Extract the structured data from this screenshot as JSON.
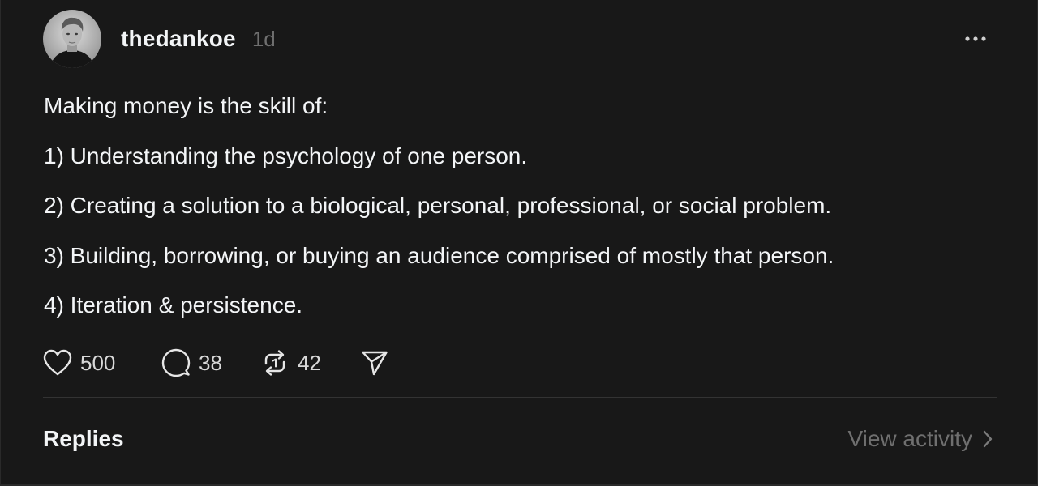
{
  "post": {
    "username": "thedankoe",
    "timestamp": "1d",
    "lines": [
      "Making money is the skill of:",
      "1) Understanding the psychology of one person.",
      "2) Creating a solution to a biological, personal, professional, or social problem.",
      "3) Building, borrowing, or buying an audience comprised of mostly that person.",
      "4) Iteration & persistence."
    ],
    "avatar_icon": "profile-photo",
    "more_icon": "ellipsis-icon"
  },
  "actions": {
    "likes": "500",
    "comments": "38",
    "reposts": "42",
    "icons": [
      "heart-icon",
      "comment-bubble-icon",
      "repost-icon",
      "share-send-icon"
    ]
  },
  "replies": {
    "title": "Replies",
    "view_activity": "View activity"
  },
  "colors": {
    "background": "#181818",
    "text_primary": "#f3f5f7",
    "text_secondary": "#6f6f6f",
    "divider": "#333333"
  }
}
